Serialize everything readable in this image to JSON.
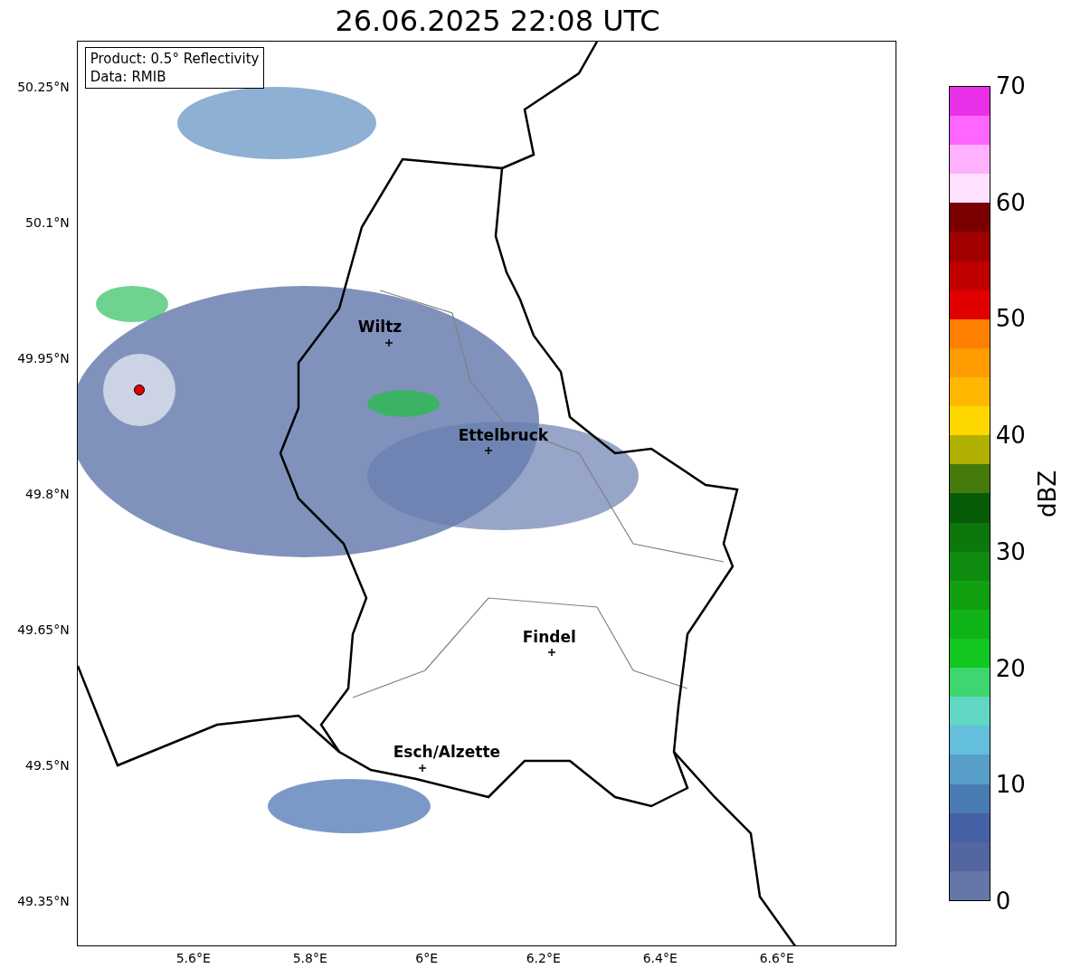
{
  "title": "26.06.2025 22:08 UTC",
  "info_box": [
    "Product: 0.5° Reflectivity",
    "Data: RMIB"
  ],
  "places": [
    {
      "name": "Wiltz"
    },
    {
      "name": "Ettelbruck"
    },
    {
      "name": "Findel"
    },
    {
      "name": "Esch/Alzette"
    }
  ],
  "lat_ticks": [
    "50.25°N",
    "50.1°N",
    "49.95°N",
    "49.8°N",
    "49.65°N",
    "49.5°N",
    "49.35°N"
  ],
  "lon_ticks": [
    "5.6°E",
    "5.8°E",
    "6°E",
    "6.2°E",
    "6.4°E",
    "6.6°E"
  ],
  "colorbar": {
    "label": "dBZ",
    "ticks": [
      "70",
      "60",
      "50",
      "40",
      "30",
      "20",
      "10",
      "0"
    ],
    "segments": [
      {
        "color": "#6676a8"
      },
      {
        "color": "#5466a0"
      },
      {
        "color": "#4561a6"
      },
      {
        "color": "#4a7bb2"
      },
      {
        "color": "#579ec8"
      },
      {
        "color": "#63bfdc"
      },
      {
        "color": "#5fd7c2"
      },
      {
        "color": "#3ed66e"
      },
      {
        "color": "#12c820"
      },
      {
        "color": "#10b318"
      },
      {
        "color": "#10a010"
      },
      {
        "color": "#0f8c10"
      },
      {
        "color": "#0c780c"
      },
      {
        "color": "#075c07"
      },
      {
        "color": "#467a0b"
      },
      {
        "color": "#b0b000"
      },
      {
        "color": "#ffd700"
      },
      {
        "color": "#ffb800"
      },
      {
        "color": "#ff9c00"
      },
      {
        "color": "#ff8000"
      },
      {
        "color": "#e00000"
      },
      {
        "color": "#c00000"
      },
      {
        "color": "#a00000"
      },
      {
        "color": "#7a0000"
      },
      {
        "color": "#ffe0ff"
      },
      {
        "color": "#ffb0ff"
      },
      {
        "color": "#ff66ff"
      },
      {
        "color": "#e830e8"
      }
    ]
  }
}
